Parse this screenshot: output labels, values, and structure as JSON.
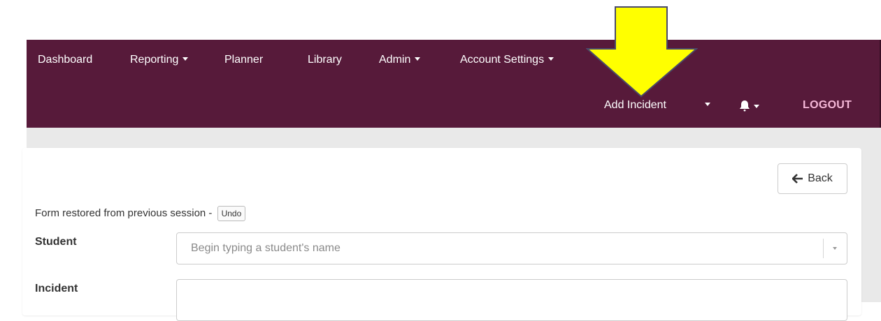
{
  "nav": {
    "items": [
      {
        "label": "Dashboard",
        "dropdown": false
      },
      {
        "label": "Reporting",
        "dropdown": true
      },
      {
        "label": "Planner",
        "dropdown": false
      },
      {
        "label": "Library",
        "dropdown": false
      },
      {
        "label": "Admin",
        "dropdown": true
      },
      {
        "label": "Account Settings",
        "dropdown": true
      }
    ],
    "add_incident": "Add Incident",
    "logout": "LOGOUT",
    "bell_icon": "bell-icon"
  },
  "colors": {
    "navbar_bg": "#571a3a",
    "logout_text": "#f6b8d8",
    "annotation_arrow": "#ffff00"
  },
  "form": {
    "back_label": "Back",
    "back_icon": "arrow-left-icon",
    "restored_text": "Form restored from previous session -",
    "undo_label": "Undo",
    "student_label": "Student",
    "student_placeholder": "Begin typing a student's name",
    "incident_label": "Incident"
  }
}
